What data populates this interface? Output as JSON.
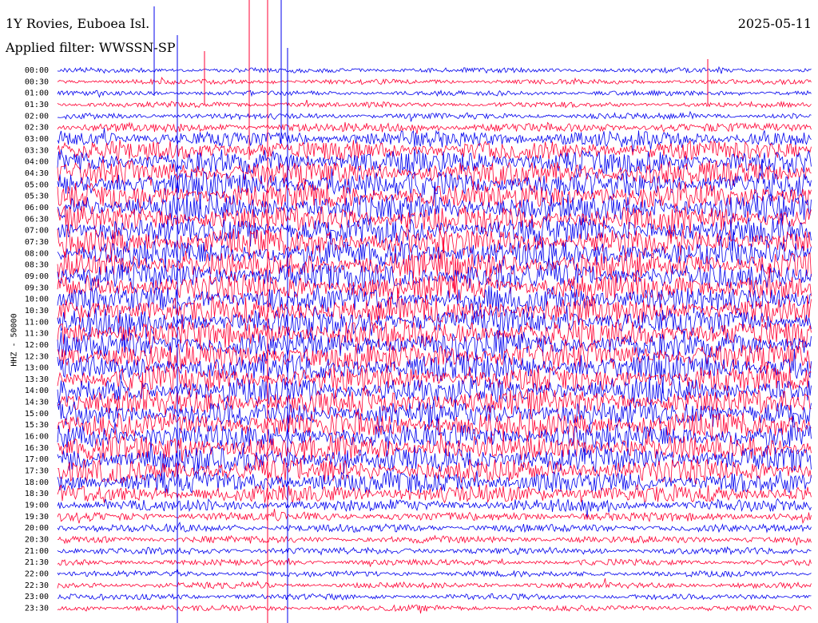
{
  "header": {
    "station": "1Y Rovies, Euboea Isl.",
    "date": "2025-05-11",
    "filter": "Applied filter: WWSSN-SP"
  },
  "chart_data": {
    "type": "line",
    "ylabel": "HHZ - 50000",
    "row_labels": [
      "00:00",
      "00:30",
      "01:00",
      "01:30",
      "02:00",
      "02:30",
      "03:00",
      "03:30",
      "04:00",
      "04:30",
      "05:00",
      "05:30",
      "06:00",
      "06:30",
      "07:00",
      "07:30",
      "08:00",
      "08:30",
      "09:00",
      "09:30",
      "10:00",
      "10:30",
      "11:00",
      "11:30",
      "12:00",
      "12:30",
      "13:00",
      "13:30",
      "14:00",
      "14:30",
      "15:00",
      "15:30",
      "16:00",
      "16:30",
      "17:00",
      "17:30",
      "18:00",
      "18:30",
      "19:00",
      "19:30",
      "20:00",
      "20:30",
      "21:00",
      "21:30",
      "22:00",
      "22:30",
      "23:00",
      "23:30"
    ],
    "series_colors": [
      "#0000ee",
      "#ff0033"
    ],
    "relative_amplitude": [
      0.25,
      0.25,
      0.25,
      0.28,
      0.3,
      0.45,
      0.8,
      1.0,
      1.2,
      1.25,
      1.3,
      1.3,
      1.35,
      1.35,
      1.35,
      1.35,
      1.35,
      1.35,
      1.35,
      1.35,
      1.35,
      1.35,
      1.35,
      1.35,
      1.35,
      1.35,
      1.35,
      1.3,
      1.3,
      1.3,
      1.3,
      1.3,
      1.3,
      1.3,
      1.25,
      1.2,
      1.1,
      0.9,
      0.6,
      0.45,
      0.4,
      0.35,
      0.35,
      0.3,
      0.3,
      0.3,
      0.3,
      0.3
    ]
  }
}
